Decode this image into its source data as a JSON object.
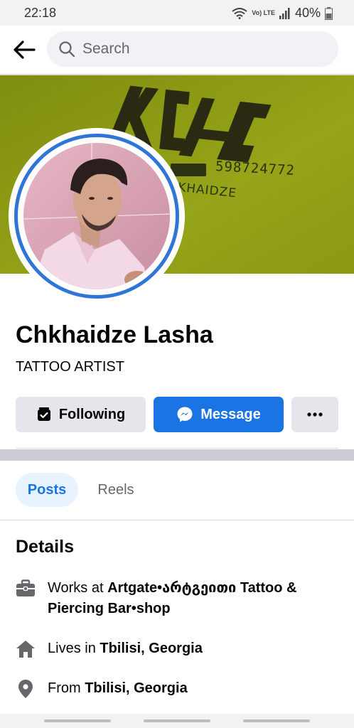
{
  "status_bar": {
    "time": "22:18",
    "network": "Vo) LTE",
    "battery": "40%"
  },
  "header": {
    "back_icon": "arrow-left-icon",
    "search_placeholder": "Search"
  },
  "cover": {
    "logo_text": "KCH",
    "phone": "598724772",
    "name_fragment": "KHAIDZE",
    "color": "#8d9a12"
  },
  "profile": {
    "name": "Chkhaidze Lasha",
    "bio": "TATTOO ARTIST",
    "ring_color": "#2f75d8"
  },
  "actions": {
    "following_label": "Following",
    "message_label": "Message",
    "more_label": "•••"
  },
  "tabs": [
    {
      "label": "Posts",
      "active": true
    },
    {
      "label": "Reels",
      "active": false
    }
  ],
  "details": {
    "title": "Details",
    "work": {
      "prefix": "Works at ",
      "value": "Artgate•არტგეითი Tattoo & Piercing Bar•shop",
      "icon": "briefcase-icon"
    },
    "lives": {
      "prefix": "Lives in ",
      "value": "Tbilisi, Georgia",
      "icon": "home-icon"
    },
    "from": {
      "prefix": "From ",
      "value": "Tbilisi, Georgia",
      "icon": "location-pin-icon"
    }
  },
  "colors": {
    "accent": "#1b74e4",
    "active_tab_bg": "#e7f3ff",
    "button_bg": "#e4e6eb"
  }
}
